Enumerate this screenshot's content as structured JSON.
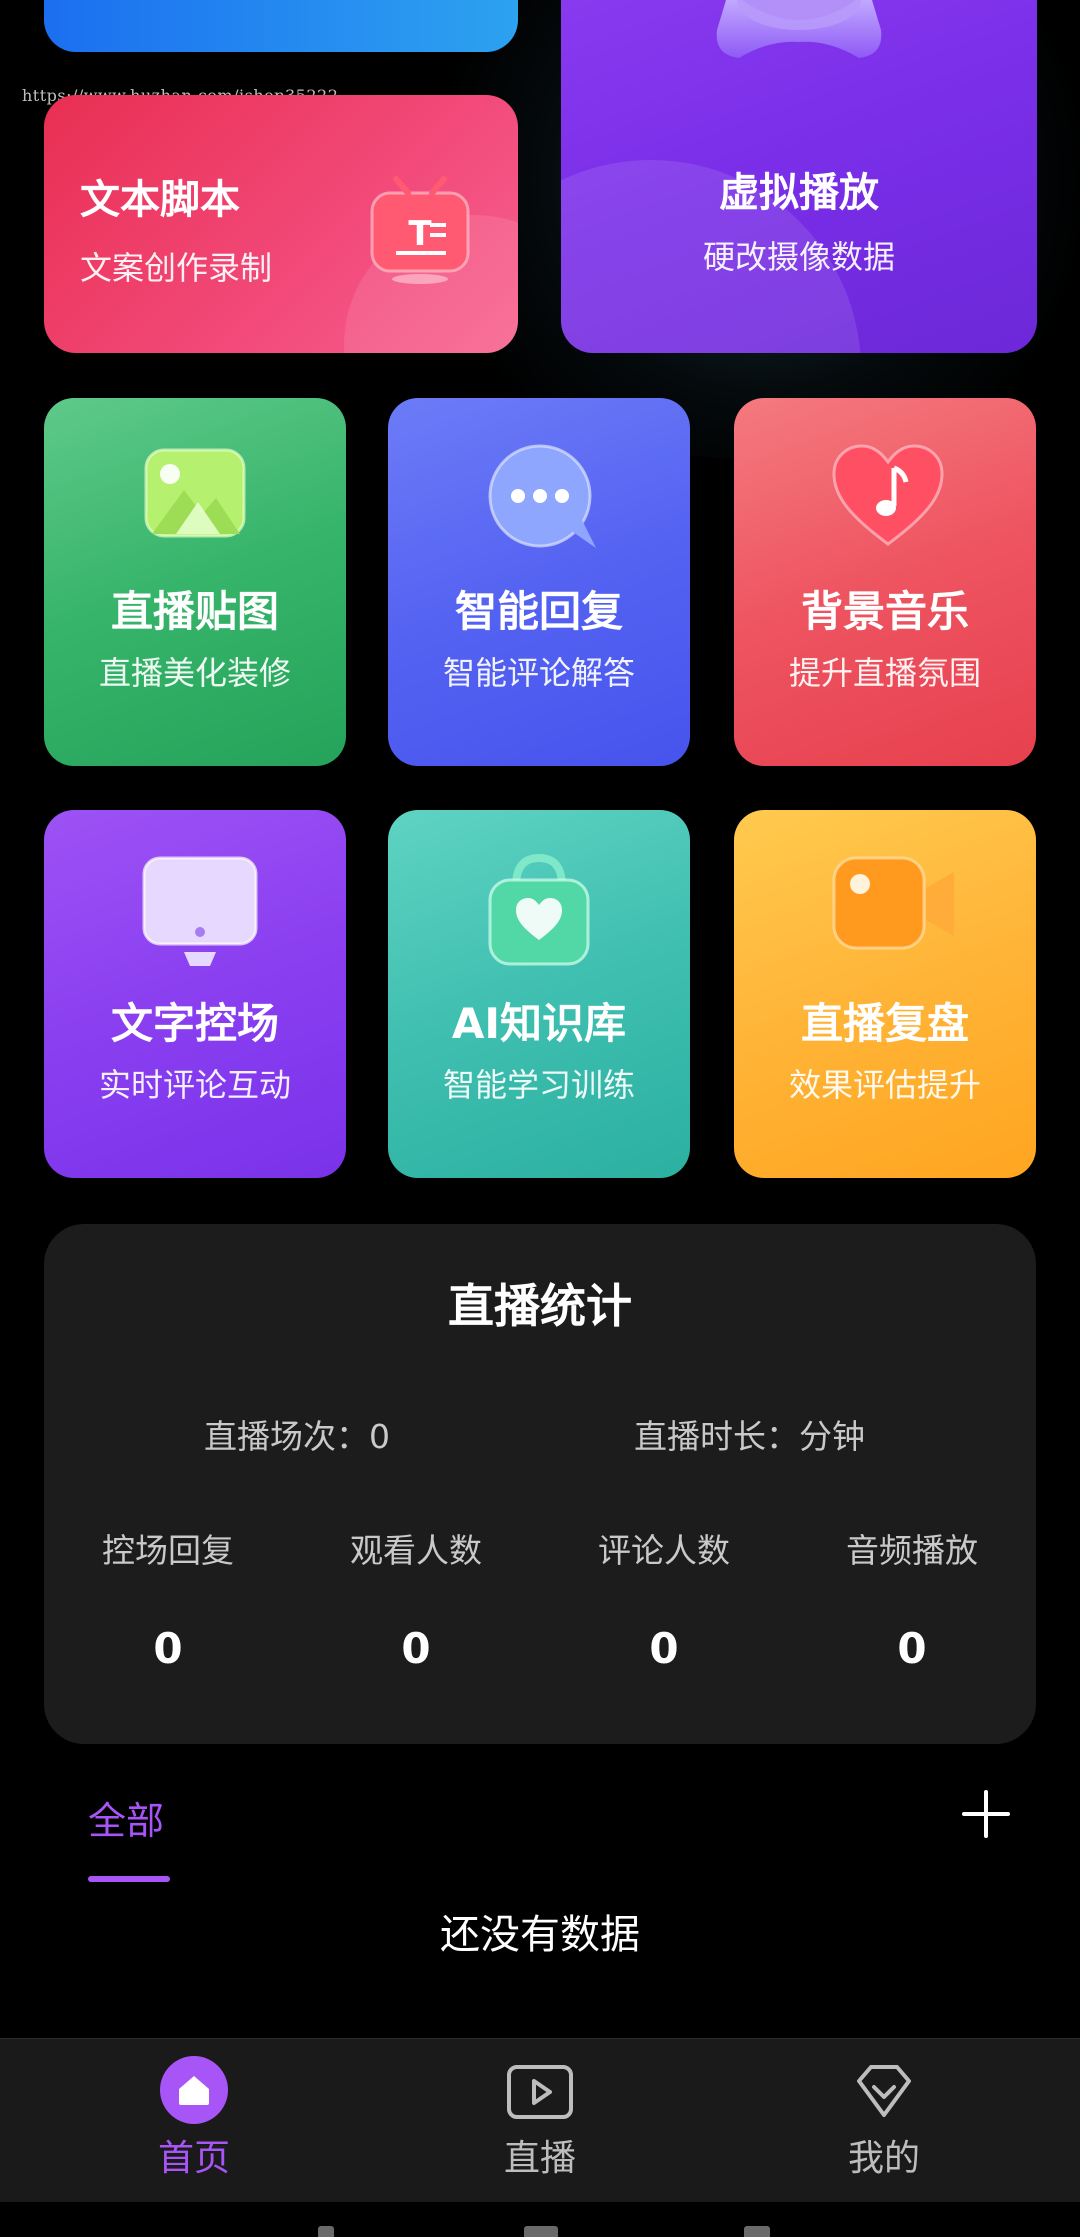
{
  "watermark": "https://www.huzhan.com/ishop35222",
  "features": {
    "script": {
      "title": "文本脚本",
      "subtitle": "文案创作录制",
      "icon": "text-script-icon"
    },
    "virtual": {
      "title": "虚拟播放",
      "subtitle": "硬改摄像数据",
      "icon": "virtual-play-icon"
    },
    "grid": [
      {
        "title": "直播贴图",
        "subtitle": "直播美化装修",
        "icon": "image-icon"
      },
      {
        "title": "智能回复",
        "subtitle": "智能评论解答",
        "icon": "chat-bubble-icon"
      },
      {
        "title": "背景音乐",
        "subtitle": "提升直播氛围",
        "icon": "music-heart-icon"
      },
      {
        "title": "文字控场",
        "subtitle": "实时评论互动",
        "icon": "monitor-icon"
      },
      {
        "title": "AI知识库",
        "subtitle": "智能学习训练",
        "icon": "bag-heart-icon"
      },
      {
        "title": "直播复盘",
        "subtitle": "效果评估提升",
        "icon": "video-camera-icon"
      }
    ]
  },
  "stats": {
    "title": "直播统计",
    "sessions": "直播场次：0",
    "duration": "直播时长：分钟",
    "columns": [
      {
        "label": "控场回复",
        "value": "0"
      },
      {
        "label": "观看人数",
        "value": "0"
      },
      {
        "label": "评论人数",
        "value": "0"
      },
      {
        "label": "音频播放",
        "value": "0"
      }
    ]
  },
  "list": {
    "tab_all": "全部",
    "empty": "还没有数据"
  },
  "nav": {
    "home": "首页",
    "live": "直播",
    "me": "我的"
  },
  "colors": {
    "accent": "#a855f7",
    "background": "#000000",
    "stats_card": "#1c1c1c"
  }
}
